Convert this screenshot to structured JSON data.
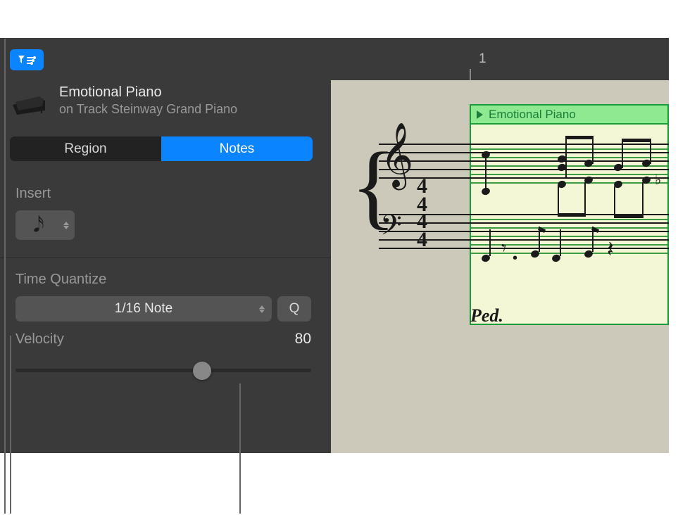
{
  "toolbar": {
    "filter_icon": "filter-icon"
  },
  "track": {
    "name": "Emotional Piano",
    "subtitle": "on Track Steinway Grand Piano"
  },
  "tabs": {
    "region": "Region",
    "notes": "Notes",
    "active": "notes"
  },
  "insert": {
    "label": "Insert",
    "note_value": "sixteenth"
  },
  "quantize": {
    "label": "Time Quantize",
    "value": "1/16 Note",
    "button": "Q"
  },
  "velocity": {
    "label": "Velocity",
    "value": "80",
    "percent": 63
  },
  "ruler": {
    "marker": "1"
  },
  "region": {
    "title": "Emotional Piano"
  },
  "score": {
    "time_signature_top": "4",
    "time_signature_bottom": "4",
    "pedal": "Ped."
  }
}
